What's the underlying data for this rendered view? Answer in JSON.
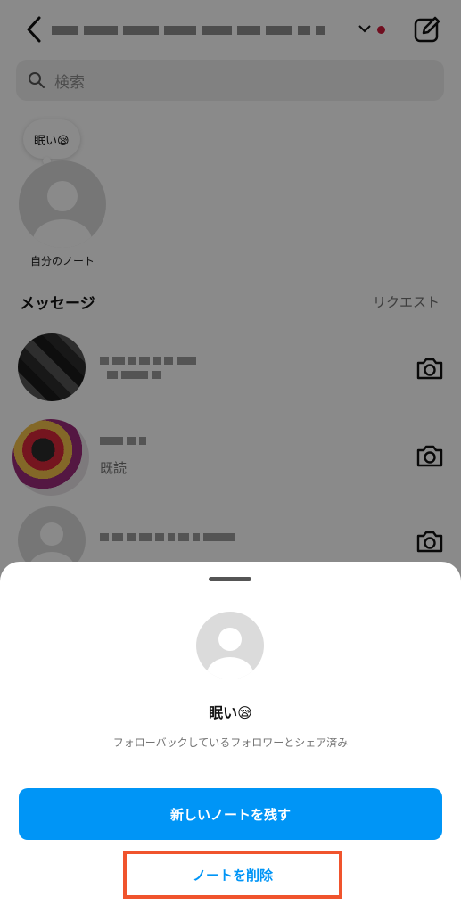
{
  "header": {
    "back_icon": "chevron-left-icon",
    "dropdown_icon": "chevron-down-icon",
    "compose_icon": "new-message-icon",
    "notification_color": "#d01a3a"
  },
  "search": {
    "placeholder": "検索",
    "icon": "search-icon"
  },
  "my_note": {
    "text": "眠い😪",
    "label": "自分のノート"
  },
  "messages": {
    "title": "メッセージ",
    "requests_label": "リクエスト",
    "rows": [
      {
        "status": "",
        "icon": "camera-icon"
      },
      {
        "status": "既読",
        "icon": "camera-icon"
      },
      {
        "status": "",
        "icon": "camera-icon"
      }
    ]
  },
  "sheet": {
    "note_text": "眠い😪",
    "audience_text": "フォローバックしているフォロワーとシェア済み",
    "primary_button": "新しいノートを残す",
    "delete_button": "ノートを削除",
    "accent_color": "#0095f6",
    "highlight_color": "#f0542d"
  }
}
